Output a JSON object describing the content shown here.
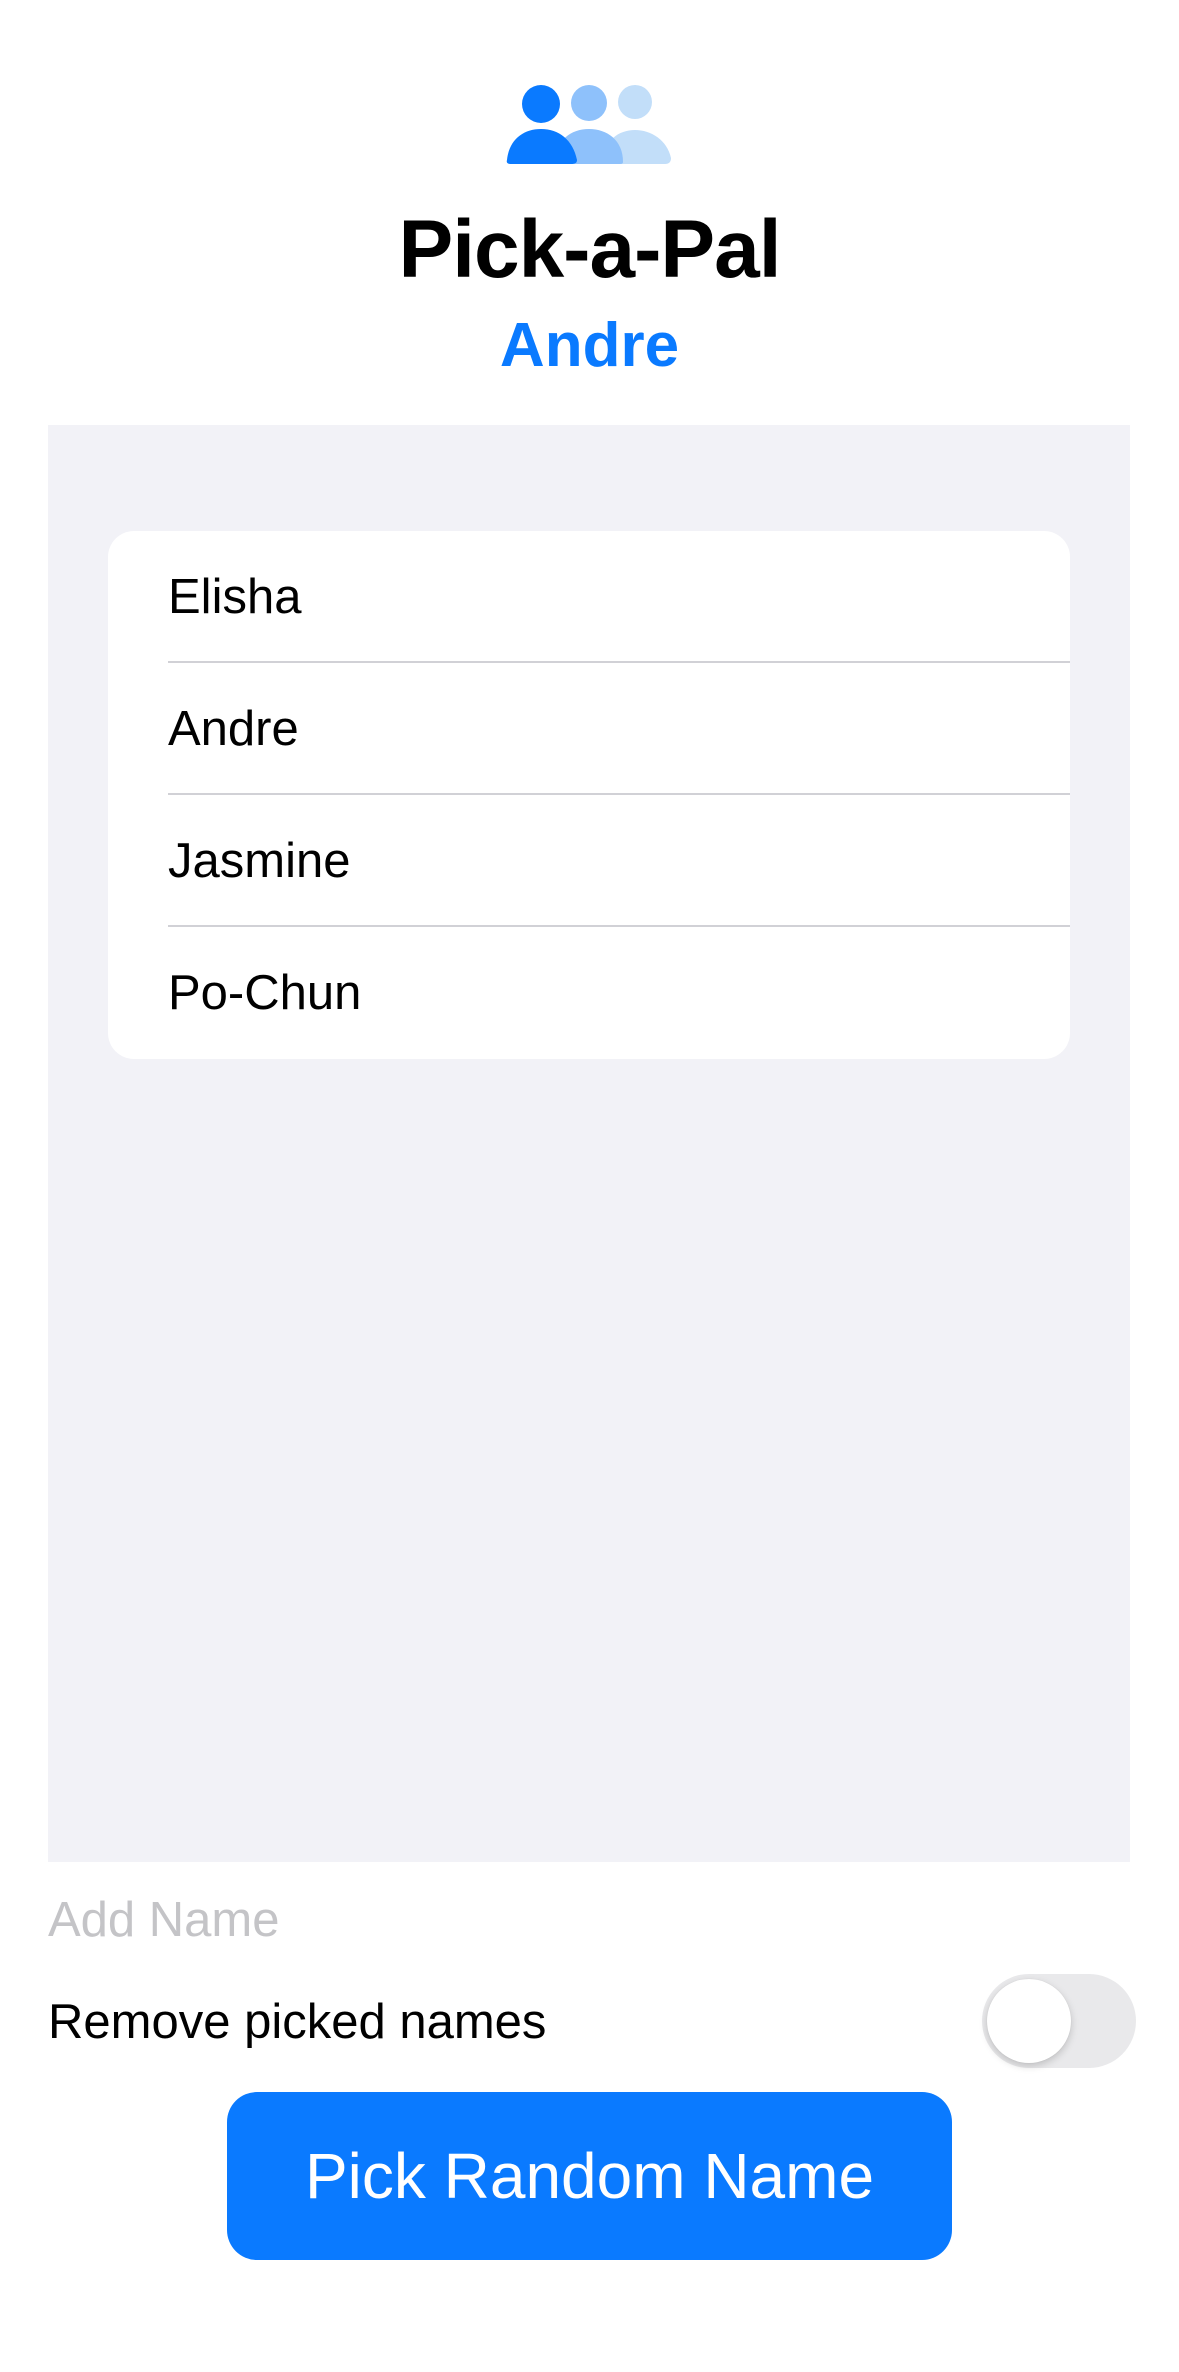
{
  "app": {
    "title": "Pick-a-Pal",
    "icon": "person-3-fill-icon",
    "picked_name": "Andre"
  },
  "names": [
    {
      "label": "Elisha"
    },
    {
      "label": "Andre"
    },
    {
      "label": "Jasmine"
    },
    {
      "label": "Po-Chun"
    }
  ],
  "add_name": {
    "value": "",
    "placeholder": "Add Name"
  },
  "remove_toggle": {
    "label": "Remove picked names",
    "on": false
  },
  "pick_button": {
    "label": "Pick Random Name"
  },
  "colors": {
    "accent": "#0a7aff",
    "icon_mid": "#8ec1fb",
    "icon_light": "#c2def9",
    "list_background": "#f2f2f7",
    "placeholder": "#c4c4c7"
  }
}
